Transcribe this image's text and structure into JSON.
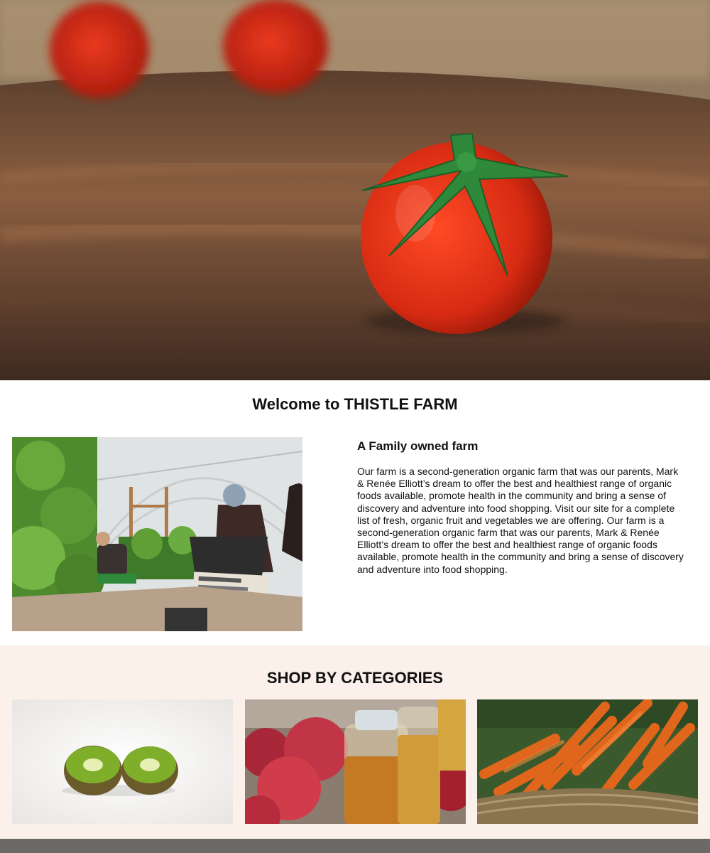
{
  "hero": {
    "image": "tomato-on-wooden-table",
    "accent_colors": {
      "tomato": "#d62a12",
      "stem": "#2e7d32",
      "wood": "#7a5238"
    }
  },
  "welcome": {
    "title": "Welcome to THISTLE FARM"
  },
  "about": {
    "image": "greenhouse-workers",
    "heading": "A Family owned farm",
    "body": "Our farm is a second-generation organic farm that was our parents, Mark & Renée Elliott’s dream to offer the best and healthiest range of organic foods available, promote health in the community and bring a sense of discovery and adventure into food shopping. Visit our site for a complete list of fresh, organic fruit and vegetables we are offering. Our farm is a second-generation organic farm that was our parents, Mark & Renée Elliott’s dream to offer the best and healthiest range of organic foods available, promote health in the community and bring a sense of discovery and adventure into food shopping."
  },
  "categories": {
    "title": "SHOP BY CATEGORIES",
    "background": "#fbf1ea",
    "items": [
      {
        "image": "kiwi-halves"
      },
      {
        "image": "apples-and-juice-bottles"
      },
      {
        "image": "carrots-in-basket"
      }
    ]
  },
  "footer": {
    "color": "#6b6a66"
  }
}
